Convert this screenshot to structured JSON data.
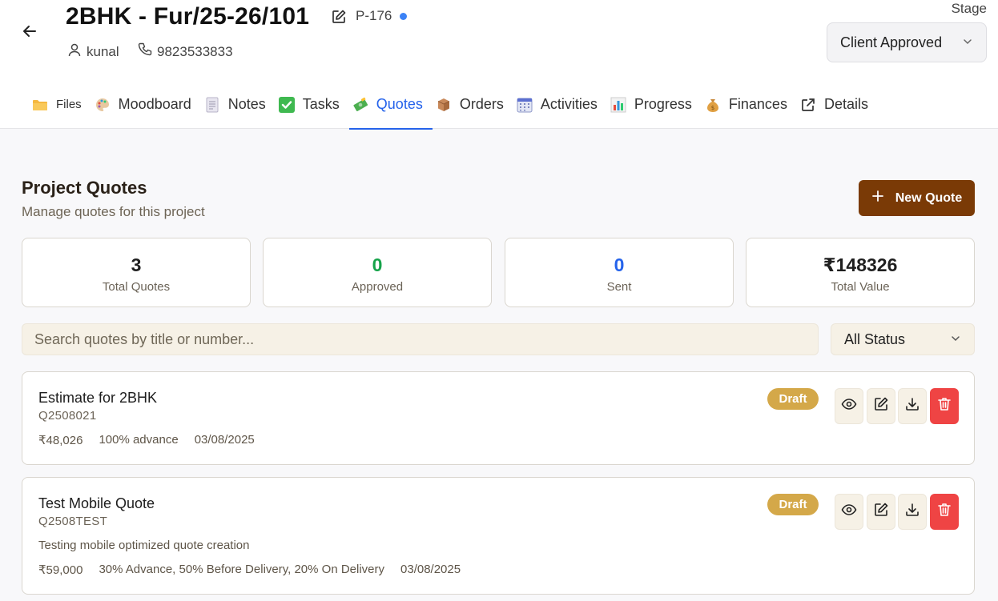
{
  "project": {
    "title": "2BHK - Fur/25-26/101",
    "code": "P-176",
    "client_name": "kunal",
    "phone": "9823533833"
  },
  "stage": {
    "label": "Stage",
    "value": "Client Approved"
  },
  "tabs": [
    {
      "label": "Files",
      "icon": "folder-icon"
    },
    {
      "label": "Moodboard",
      "icon": "palette-icon"
    },
    {
      "label": "Notes",
      "icon": "notepad-icon"
    },
    {
      "label": "Tasks",
      "icon": "check-box-icon"
    },
    {
      "label": "Quotes",
      "icon": "money-icon",
      "active": true
    },
    {
      "label": "Orders",
      "icon": "package-icon"
    },
    {
      "label": "Activities",
      "icon": "calendar-icon"
    },
    {
      "label": "Progress",
      "icon": "bar-chart-icon"
    },
    {
      "label": "Finances",
      "icon": "money-bag-icon"
    },
    {
      "label": "Details",
      "icon": "external-link-icon"
    }
  ],
  "section": {
    "title": "Project Quotes",
    "subtitle": "Manage quotes for this project",
    "new_button": "New Quote"
  },
  "stats": [
    {
      "value": "3",
      "label": "Total Quotes",
      "color": "#1f1f1f"
    },
    {
      "value": "0",
      "label": "Approved",
      "color": "#16a34a"
    },
    {
      "value": "0",
      "label": "Sent",
      "color": "#2563eb"
    },
    {
      "value": "₹148326",
      "label": "Total Value",
      "color": "#1f1f1f"
    }
  ],
  "search": {
    "placeholder": "Search quotes by title or number..."
  },
  "status_filter": {
    "value": "All Status"
  },
  "quotes": [
    {
      "title": "Estimate for 2BHK",
      "number": "Q2508021",
      "description": "",
      "amount": "₹48,026",
      "terms": "100% advance",
      "date": "03/08/2025",
      "status": "Draft"
    },
    {
      "title": "Test Mobile Quote",
      "number": "Q2508TEST",
      "description": "Testing mobile optimized quote creation",
      "amount": "₹59,000",
      "terms": "30% Advance, 50% Before Delivery, 20% On Delivery",
      "date": "03/08/2025",
      "status": "Draft"
    }
  ],
  "colors": {
    "accent": "#2563eb",
    "primary_button": "#7a3a06",
    "draft_badge": "#d4a849",
    "delete": "#ef4444"
  }
}
